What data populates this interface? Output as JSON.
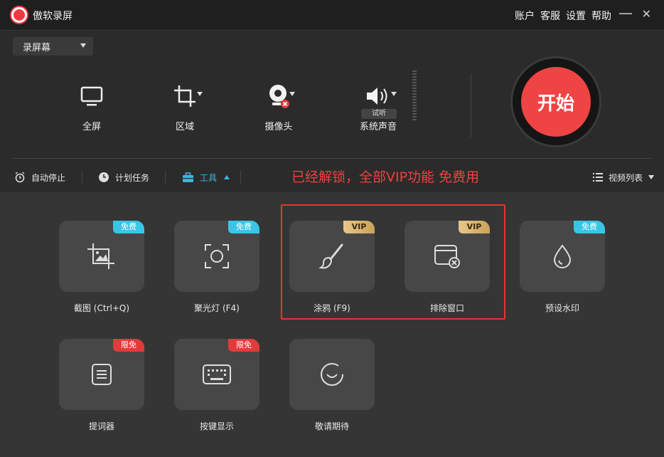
{
  "app": {
    "title": "傲软录屏"
  },
  "top_menu": [
    "账户",
    "客服",
    "设置",
    "帮助"
  ],
  "window": {
    "minimize": "—",
    "close": "✕"
  },
  "mode": {
    "selected": "录屏幕"
  },
  "sources": [
    {
      "label": "全屏",
      "icon": "monitor-icon"
    },
    {
      "label": "区域",
      "icon": "crop-region-icon"
    },
    {
      "label": "摄像头",
      "icon": "webcam-icon"
    },
    {
      "label": "系统声音",
      "icon": "speaker-icon"
    }
  ],
  "audio_trial": "试听",
  "start_button": "开始",
  "bottom_bar": {
    "auto_stop": "自动停止",
    "schedule": "计划任务",
    "tools": "工具",
    "video_list": "视频列表"
  },
  "promo_text": "已经解锁，全部VIP功能 免费用",
  "tools": [
    {
      "name": "截图 (Ctrl+Q)",
      "badge": "免费",
      "badge_type": "free",
      "icon": "screenshot-icon"
    },
    {
      "name": "聚光灯 (F4)",
      "badge": "免费",
      "badge_type": "free",
      "icon": "spotlight-icon"
    },
    {
      "name": "涂鸦 (F9)",
      "badge": "VIP",
      "badge_type": "vip",
      "icon": "brush-icon"
    },
    {
      "name": "排除窗口",
      "badge": "VIP",
      "badge_type": "vip",
      "icon": "exclude-window-icon"
    },
    {
      "name": "预设水印",
      "badge": "免费",
      "badge_type": "free",
      "icon": "watermark-drop-icon"
    },
    {
      "name": "提词器",
      "badge": "限免",
      "badge_type": "limited",
      "icon": "teleprompter-icon"
    },
    {
      "name": "按键显示",
      "badge": "限免",
      "badge_type": "limited",
      "icon": "keyboard-icon"
    },
    {
      "name": "敬请期待",
      "badge": "",
      "badge_type": "",
      "icon": "coming-soon-icon"
    }
  ],
  "colors": {
    "accent": "#ef4444",
    "tools_active": "#38b6e6",
    "promo": "#f04040",
    "highlight": "#e8342f"
  }
}
